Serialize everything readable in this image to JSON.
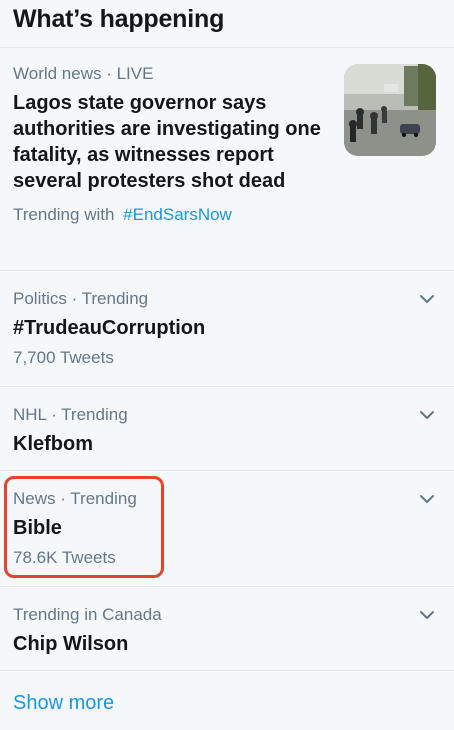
{
  "header": {
    "title": "What’s happening"
  },
  "featured": {
    "meta": "World news · LIVE",
    "headline": "Lagos state governor says authorities are investigating one fatality, as witnesses report several protesters shot dead",
    "trending_with_label": "Trending with",
    "trending_with_tag": "#EndSarsNow"
  },
  "trends": [
    {
      "meta": "Politics · Trending",
      "title": "#TrudeauCorruption",
      "count": "7,700 Tweets"
    },
    {
      "meta": "NHL · Trending",
      "title": "Klefbom",
      "count": ""
    },
    {
      "meta": "News · Trending",
      "title": "Bible",
      "count": "78.6K Tweets"
    },
    {
      "meta": "Trending in Canada",
      "title": "Chip Wilson",
      "count": ""
    }
  ],
  "footer": {
    "show_more": "Show more"
  },
  "colors": {
    "accent": "#1b95e0",
    "highlight": "#e8412c",
    "muted": "#657786"
  },
  "icons": {
    "more": "chevron-down-icon"
  }
}
